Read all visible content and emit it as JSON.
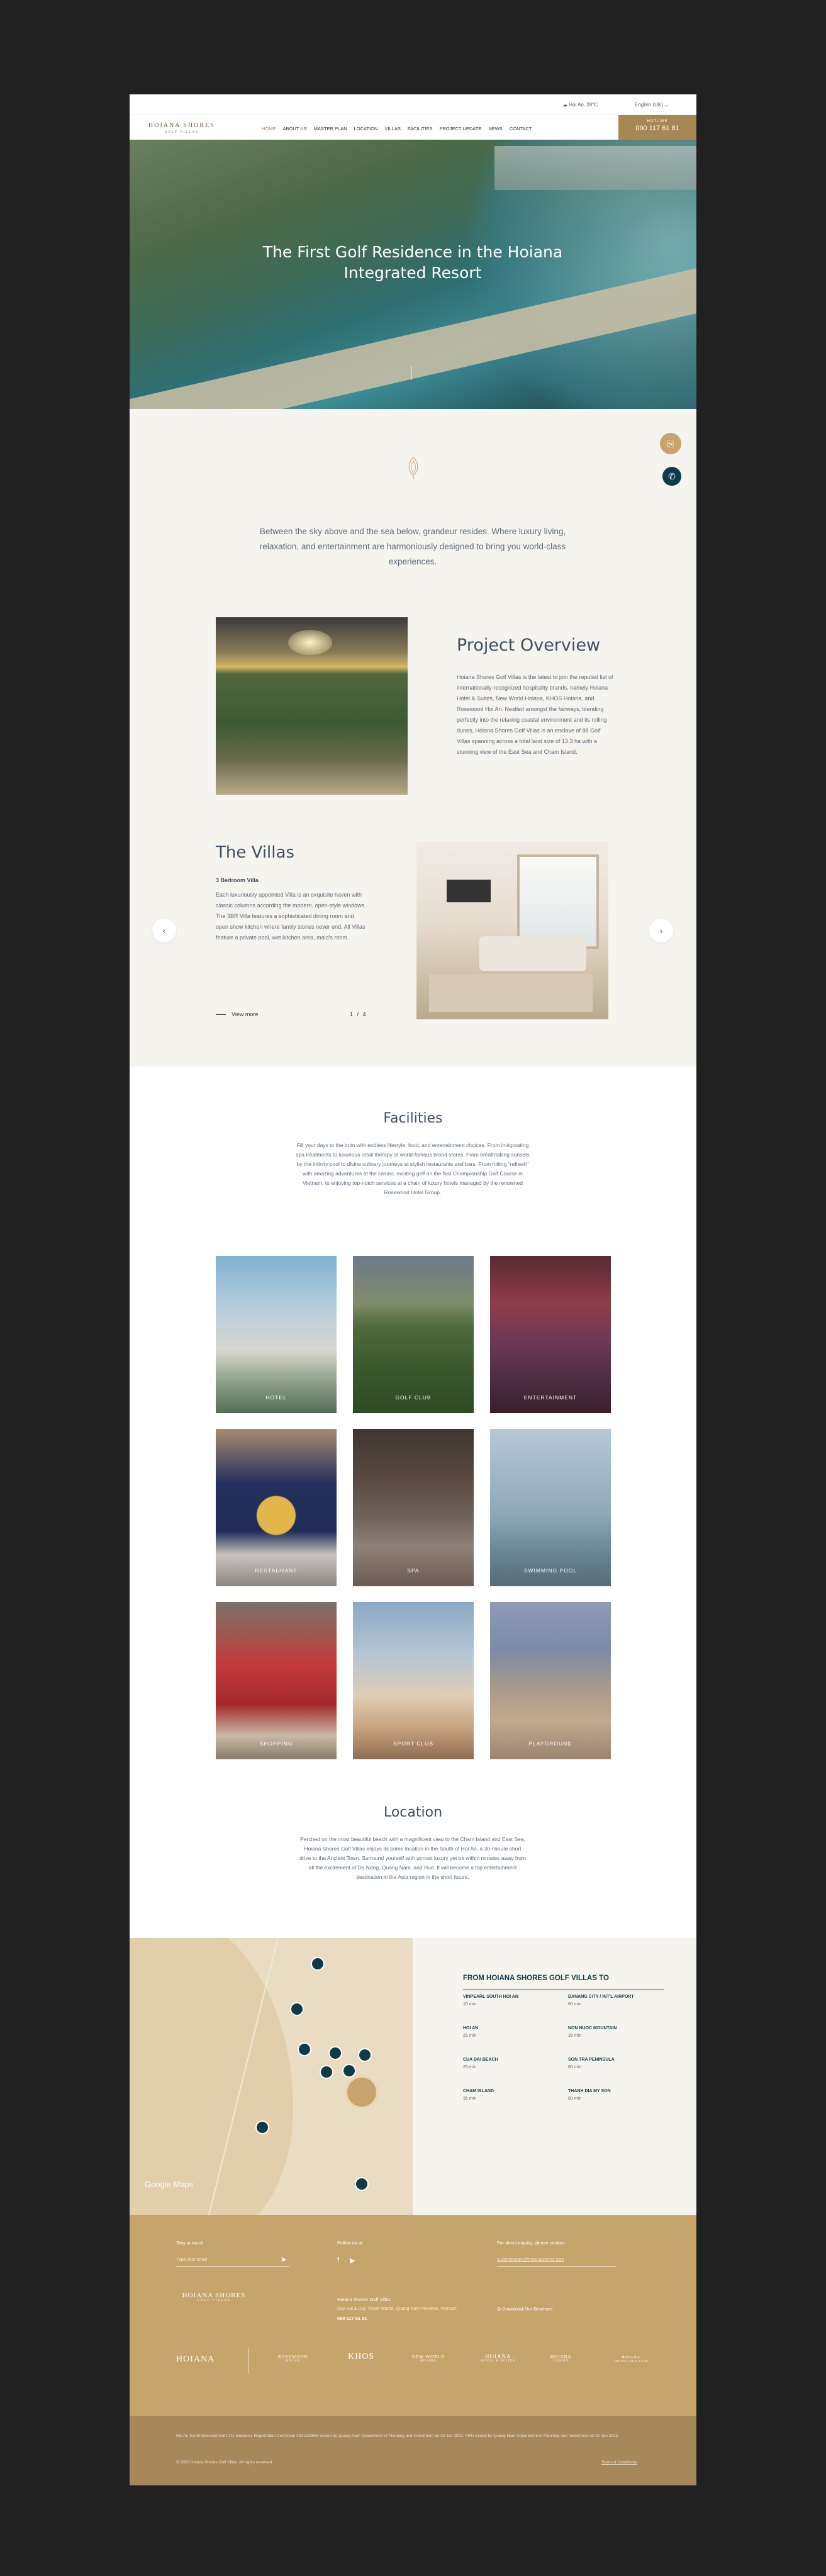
{
  "topbar": {
    "weather": "Hoi An, 28°C",
    "language": "English (UK)"
  },
  "nav": {
    "logo": "HOIANA SHORES",
    "logo_sub": "GOLF VILLAS",
    "items": [
      "HOME",
      "ABOUT US",
      "MASTER PLAN",
      "LOCATION",
      "VILLAS",
      "FACILITIES",
      "PROJECT UPDATE",
      "NEWS",
      "CONTACT"
    ],
    "hotline_label": "HOTLINE",
    "hotline_number": "090 117 61 81"
  },
  "hero": {
    "title": "The First Golf Residence in the Hoiana Integrated Resort"
  },
  "intro": {
    "text": "Between the sky above and the sea below, grandeur resides. Where luxury living, relaxation, and entertainment are harmoniously designed to bring you world-class experiences."
  },
  "overview": {
    "title": "Project Overview",
    "text": "Hoiana Shores Golf Villas is the latest to join the reputed list of internationally-recognized hospitality brands, namely Hoiana Hotel & Suites, New World Hoiana, KHOS Hoiana, and Rosewood Hoi An. Nestled amongst the fairways, blending perfectly into the relaxing coastal environment and its rolling dunes, Hoiana Shores Golf Villas is an enclave of 88 Golf Villas spanning across a total land size of 13.3 ha with a stunning view of the East Sea and Cham Island."
  },
  "villas": {
    "title": "The Villas",
    "subtitle": "3 Bedroom Villa",
    "text": "Each luxuriously appointed Villa is an exquisite haven with classic columns according the modern, open-style windows. The 3BR Villa features a sophisticated dining room and open show kitchen where family stories never end. All Villas feature a private pool, wet kitchen area, maid's room.",
    "view_more": "View more",
    "pager": "1 / 4"
  },
  "facilities": {
    "title": "Facilities",
    "text": "Fill your days to the brim with endless lifestyle, food, and entertainment choices. From invigorating spa treatments to luxurious retail therapy at world-famous brand stores. From breathtaking sunsets by the infinity pool to divine culinary journeys at stylish restaurants and bars. From hitting \"refresh\" with amazing adventures at the casino, exciting golf on the first Championship Golf Course in Vietnam, to enjoying top-notch services at a chain of luxury hotels managed by the renowned Rosewood Hotel Group.",
    "tiles": [
      "HOTEL",
      "GOLF CLUB",
      "ENTERTAINMENT",
      "RESTAURANT",
      "SPA",
      "SWIMMING POOL",
      "SHOPPING",
      "SPORT CLUB",
      "PLAYGROUND"
    ]
  },
  "location": {
    "title": "Location",
    "text": "Perched on the most beautiful beach with a magnificent view to the Cham Island and East Sea, Hoiana Shores Golf Villas enjoys its prime location in the South of Hoi An, a 30-minute short drive to the Ancient Town. Surround yourself with utmost luxury yet be within minutes away from all the excitement of Da Nang, Quang Nam, and Hue. It will become a top entertainment destination in the Asia region in the short future."
  },
  "map": {
    "credit": "Google Maps"
  },
  "distances": {
    "title": "FROM HOIANA SHORES GOLF VILLAS TO",
    "items": [
      {
        "name": "VINPEARL SOUTH HOI AN",
        "value": "10 min"
      },
      {
        "name": "DANANG CITY / INT'L AIRPORT",
        "value": "60 min"
      },
      {
        "name": "HOI AN",
        "value": "25 min"
      },
      {
        "name": "NON NUOC MOUNTAIN",
        "value": "38 min"
      },
      {
        "name": "CUA DAI BEACH",
        "value": "25 min"
      },
      {
        "name": "SON TRA PENINSULA",
        "value": "80 min"
      },
      {
        "name": "CHAM ISLAND",
        "value": "36 min"
      },
      {
        "name": "THANH DIA MY SON",
        "value": "80 min"
      }
    ]
  },
  "footer": {
    "stay_label": "Stay in touch",
    "email_placeholder": "Type your email",
    "follow_label": "Follow us at",
    "sales_label": "For direct inquiry, please contact",
    "sales_email": "customercare@hoianashores.com",
    "company": "Hoiana Shores Golf Villas",
    "address": "Duy Hai & Duy Thanh Wards, Quang Nam Province, Vietnam",
    "phone": "090 117 61 81",
    "brochure": "Download Our Brochure",
    "logo": "HOIANA SHORES",
    "logo_sub": "GOLF VILLAS",
    "brands": [
      "HOIANA",
      "ROSEWOOD",
      "KHOS",
      "NEW WORLD",
      "HOIANA",
      "HOIANA",
      "HOIANA"
    ],
    "brand_subs": [
      "",
      "HOI AN",
      "",
      "HOIANA",
      "HOTEL & SUITES",
      "CASINO",
      "SHORES GOLF CLUB"
    ],
    "legal": "Hoi An South Development LTD. Business Registration Certificate 4201183669 issued by Quang Nam Department of Planning and Investment on 20 Jun 2022. PRN issued by Quang Nam Department of Planning and Investment on 20 Jun 2022.",
    "copyright": "© 2022 Hoiana Shores Golf Villas. All rights reserved.",
    "terms": "Terms & Conditions"
  },
  "colors": {
    "accent": "#c6a46c",
    "dark": "#0f3b46",
    "heading": "#3f4f63"
  }
}
